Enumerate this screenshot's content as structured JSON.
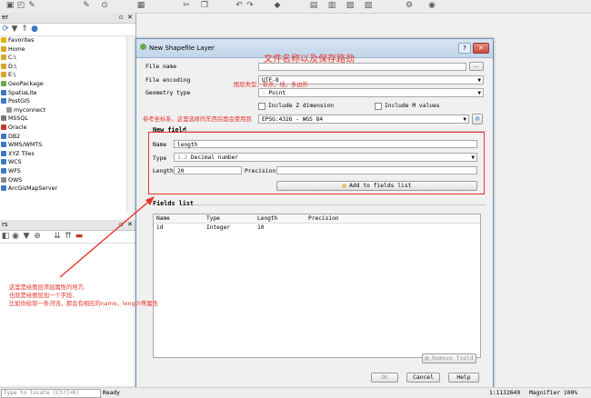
{
  "browser_panel": {
    "title_fragment": "er",
    "items": [
      {
        "label": "Favorites",
        "color": "#e0b400"
      },
      {
        "label": "Home",
        "color": "#d8a62e"
      },
      {
        "label": "C:\\",
        "color": "#d8a62e"
      },
      {
        "label": "D:\\",
        "color": "#d8a62e"
      },
      {
        "label": "E:\\",
        "color": "#d8a62e"
      },
      {
        "label": "GeoPackage",
        "color": "#6aa84f"
      },
      {
        "label": "SpatiaLite",
        "color": "#3b78c2"
      },
      {
        "label": "PostGIS",
        "color": "#3b78c2"
      },
      {
        "label": "myconnect",
        "color": "#999999"
      },
      {
        "label": "MSSQL",
        "color": "#777777"
      },
      {
        "label": "Oracle",
        "color": "#c0392b"
      },
      {
        "label": "DB2",
        "color": "#3b78c2"
      },
      {
        "label": "WMS/WMTS",
        "color": "#3b78c2"
      },
      {
        "label": "XYZ Tiles",
        "color": "#3b78c2"
      },
      {
        "label": "WCS",
        "color": "#3b78c2"
      },
      {
        "label": "WFS",
        "color": "#3b78c2"
      },
      {
        "label": "OWS",
        "color": "#888888"
      },
      {
        "label": "ArcGisMapServer",
        "color": "#3b78c2"
      }
    ]
  },
  "layers_panel": {
    "title_fragment": "rs"
  },
  "dialog": {
    "title": "New Shapefile Layer",
    "help_glyph": "?",
    "close_glyph": "✕",
    "file_name_label": "File name",
    "file_name_value": "",
    "browse_label": "...",
    "encoding_label": "File encoding",
    "encoding_value": "UTF-8",
    "geometry_label": "Geometry type",
    "geometry_value": "Point",
    "include_z_label": "Include Z dimension",
    "include_m_label": "Include M values",
    "crs_value": "EPSG:4326 - WGS 84",
    "new_field_title": "New field",
    "name_label": "Name",
    "name_value": "length",
    "type_label": "Type",
    "type_value": "Decimal number",
    "type_icon_text": "1.2",
    "length_label": "Length",
    "length_value": "20",
    "precision_label": "Precision",
    "precision_value": "",
    "add_field_label": "Add to fields list",
    "fields_list_title": "Fields list",
    "columns": [
      "Name",
      "Type",
      "Length",
      "Precision"
    ],
    "rows": [
      {
        "name": "id",
        "type": "Integer",
        "length": "10",
        "precision": ""
      }
    ],
    "remove_field_label": "Remove field",
    "ok_label": "OK",
    "cancel_label": "Cancel",
    "help_label": "Help"
  },
  "annotations": {
    "title_note": "文件名称以及保存路劲",
    "geometry_note": "图层类型，有点，线，多边形",
    "crs_note": "参考坐标系，这里选择的东西后面会使用到",
    "field_note_line1": "这里是给图层添加属性的地方,",
    "field_note_line2": "也就是给图层加一个字段,",
    "field_note_line3": "比如你绘制一条河流，那会有相应的name，length等属性",
    "color": "#e8332b"
  },
  "status": {
    "locate_placeholder": "Type to locate (Ctrl+K)",
    "ready": "Ready",
    "scale_fragment": "1:1132649",
    "magnifier": "Magnifier 100%"
  }
}
